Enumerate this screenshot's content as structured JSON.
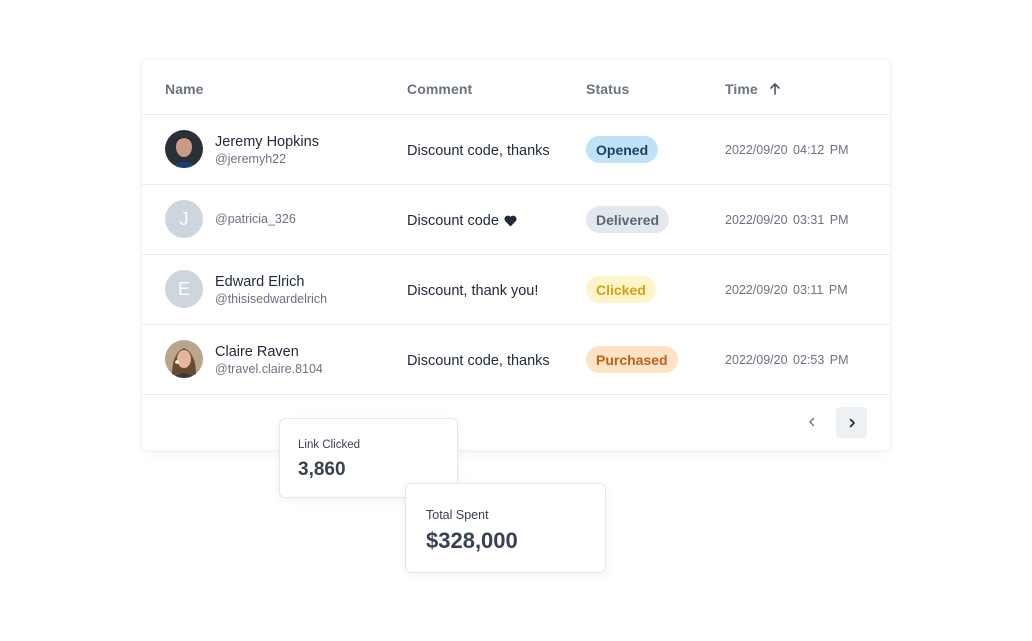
{
  "table": {
    "columns": {
      "name": "Name",
      "comment": "Comment",
      "status": "Status",
      "time": "Time"
    },
    "sort_icon": "arrow-up-icon",
    "rows": [
      {
        "name": "Jeremy Hopkins",
        "handle": "@jeremyh22",
        "avatar": "photo",
        "comment": "Discount code, thanks",
        "status": "Opened",
        "time": "2022/09/20 04:12 PM"
      },
      {
        "name": "",
        "handle": "@patricia_326",
        "avatar_initial": "J",
        "comment": "Discount code",
        "comment_icon": "heart-icon",
        "status": "Delivered",
        "time": "2022/09/20 03:31 PM"
      },
      {
        "name": "Edward Elrich",
        "handle": "@thisisedwardelrich",
        "avatar_initial": "E",
        "comment": "Discount, thank you!",
        "status": "Clicked",
        "time": "2022/09/20 03:11 PM"
      },
      {
        "name": "Claire Raven",
        "handle": "@travel.claire.8104",
        "avatar": "photo",
        "comment": "Discount code, thanks",
        "status": "Purchased",
        "time": "2022/09/20 02:53 PM"
      }
    ],
    "status_colors": {
      "Opened": "#bfe2f7",
      "Delivered": "#e3e8ee",
      "Clicked": "#fdf5c9",
      "Purchased": "#fde3c4"
    },
    "pagination": {
      "prev_icon": "chevron-left-icon",
      "next_icon": "chevron-right-icon"
    }
  },
  "stats": {
    "link_clicked": {
      "label": "Link Clicked",
      "value": "3,860"
    },
    "total_spent": {
      "label": "Total Spent",
      "value": "$328,000"
    }
  }
}
